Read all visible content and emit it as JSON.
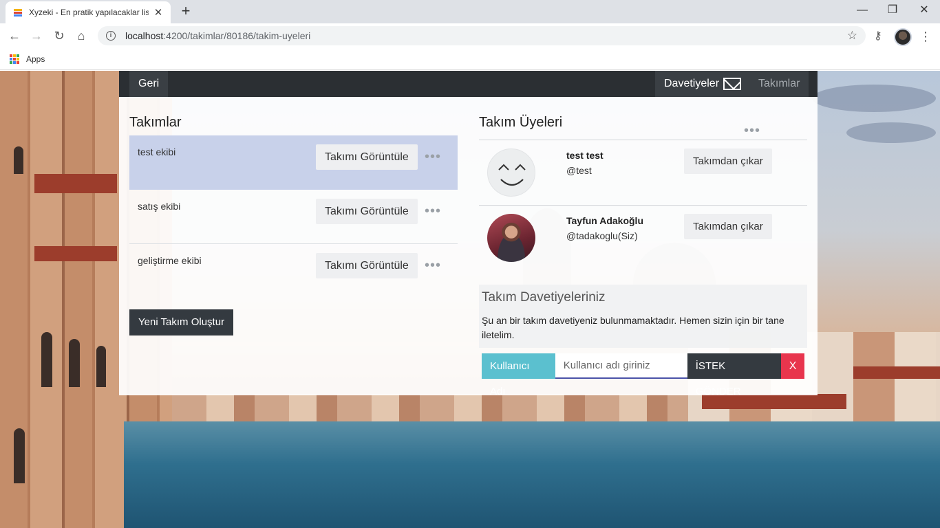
{
  "browser": {
    "tab_title": "Xyzeki - En pratik yapılacaklar list",
    "tab_close": "✕",
    "new_tab": "+",
    "url_host": "localhost",
    "url_path": ":4200/takimlar/80186/takim-uyeleri",
    "bookmark_apps": "Apps",
    "icons": {
      "back": "arrow-left-icon",
      "forward": "arrow-right-icon",
      "reload": "reload-icon",
      "home": "home-icon",
      "star": "star-icon",
      "key": "key-icon",
      "menu": "kebab-menu-icon"
    }
  },
  "nav": {
    "back_label": "Geri",
    "invites_label": "Davetiyeler",
    "teams_label": "Takımlar"
  },
  "teams": {
    "title": "Takımlar",
    "view_label": "Takımı Görüntüle",
    "items": [
      {
        "name": "test ekibi"
      },
      {
        "name": "satış ekibi"
      },
      {
        "name": "geliştirme ekibi"
      }
    ],
    "create_label": "Yeni Takım Oluştur"
  },
  "members": {
    "title": "Takım Üyeleri",
    "remove_label": "Takımdan çıkar",
    "items": [
      {
        "name": "test test",
        "username": "@test"
      },
      {
        "name": "Tayfun Adakoğlu",
        "username": "@tadakoglu(Siz)"
      }
    ]
  },
  "invitations": {
    "title": "Takım Davetiyeleriniz",
    "empty_text": "Şu an bir takım davetiyeniz bulunmamaktadır. Hemen sizin için bir tane iletelim.",
    "username_label": "Kullanıcı Adı",
    "username_placeholder": "Kullanıcı adı giriniz",
    "send_label": "İSTEK GÖNDER",
    "clear_label": "X"
  },
  "colors": {
    "nav_bg": "#2b2f33",
    "active_row": "#c5cfe9",
    "input_label": "#5bc0cf",
    "danger": "#e8354d",
    "dark_button": "#343a40"
  }
}
